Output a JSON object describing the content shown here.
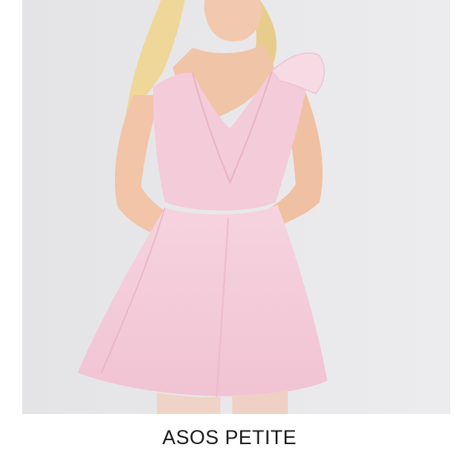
{
  "product_image": {
    "brand_caption": "ASOS PETITE",
    "colors": {
      "background": "#e6e6e8",
      "dress": "#f4cbd9",
      "dress_shadow": "#e9b3c6",
      "skin": "#f2c9ae",
      "hair": "#efd79a",
      "caption_text": "#1a1a1a"
    }
  }
}
